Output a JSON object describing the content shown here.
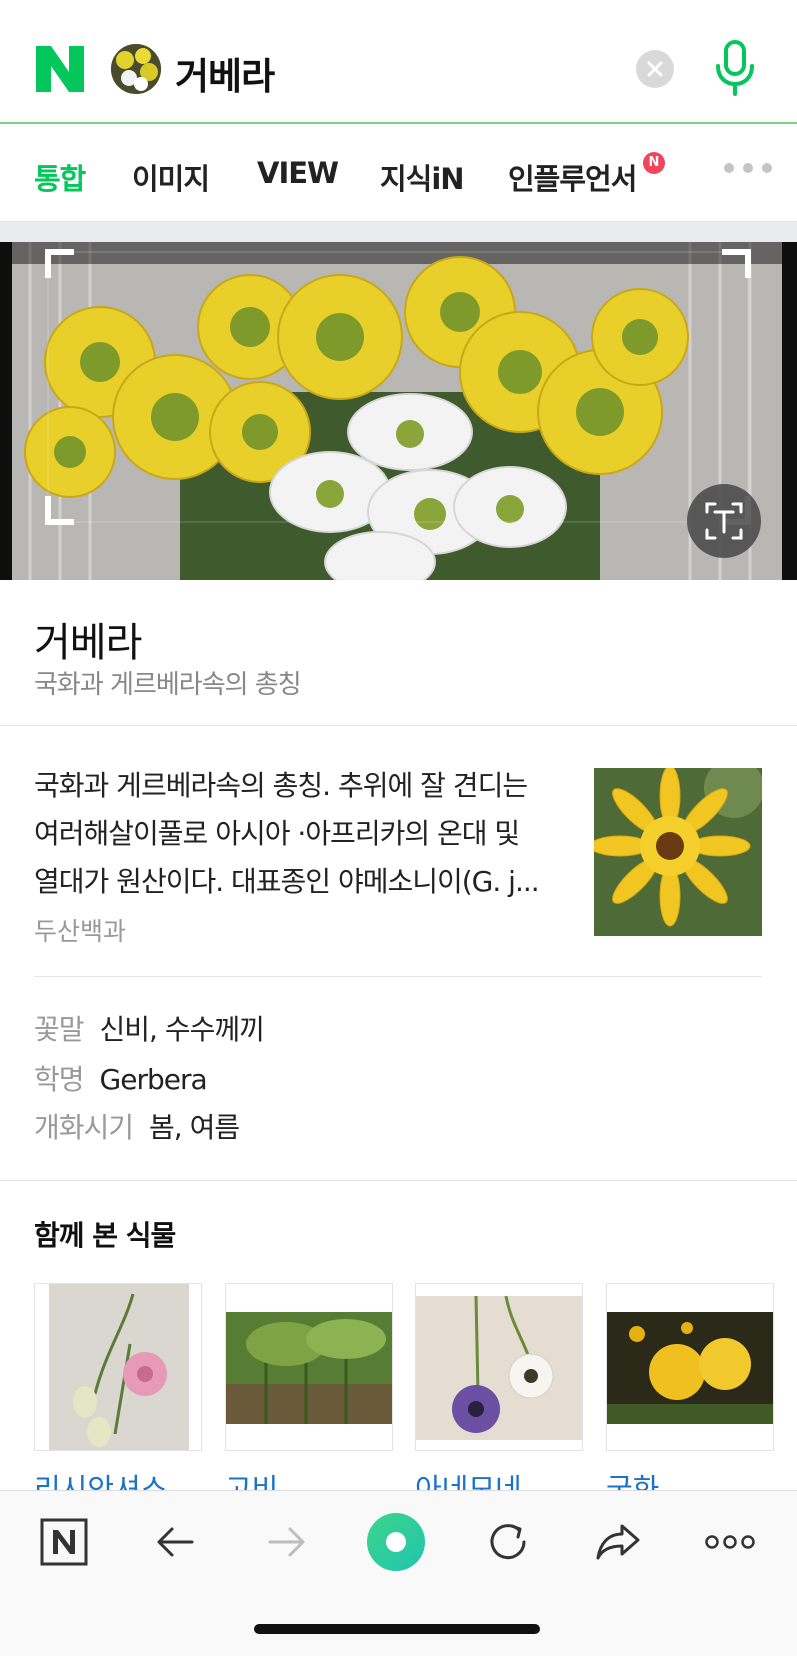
{
  "search": {
    "query": "거베라",
    "logo": "naver-n-logo",
    "clear_icon": "clear-icon",
    "mic_icon": "microphone-icon"
  },
  "tabs": [
    {
      "label": "통합",
      "active": true
    },
    {
      "label": "이미지",
      "active": false
    },
    {
      "label": "VIEW",
      "active": false
    },
    {
      "label": "지식iN",
      "active": false
    },
    {
      "label": "인플루언서",
      "active": false,
      "badge": "N"
    }
  ],
  "colors": {
    "brand_green": "#03c75a",
    "link_blue": "#1a73c9",
    "badge_red": "#f0455a"
  },
  "result": {
    "name": "거베라",
    "subtitle": "국화과 게르베라속의 총칭",
    "description_lines": [
      "국화과 게르베라속의 총칭. 추위에 잘 견디는",
      "여러해살이풀로 아시아 ·아프리카의 온대 및",
      "열대가 원산이다. 대표종인 야메소니이(G. j..."
    ],
    "source": "두산백과",
    "info": [
      {
        "label": "꽃말",
        "value": "신비, 수수께끼"
      },
      {
        "label": "학명",
        "value": "Gerbera"
      },
      {
        "label": "개화시기",
        "value": "봄, 여름"
      }
    ]
  },
  "related": {
    "title": "함께 본 식물",
    "items": [
      {
        "label": "리시안셔스"
      },
      {
        "label": "고비"
      },
      {
        "label": "아네모네"
      },
      {
        "label": "국화"
      }
    ]
  },
  "toolbar": {
    "items": [
      "home-icon",
      "back-icon",
      "forward-icon",
      "green-dot-icon",
      "refresh-icon",
      "share-icon",
      "more-icon"
    ]
  }
}
